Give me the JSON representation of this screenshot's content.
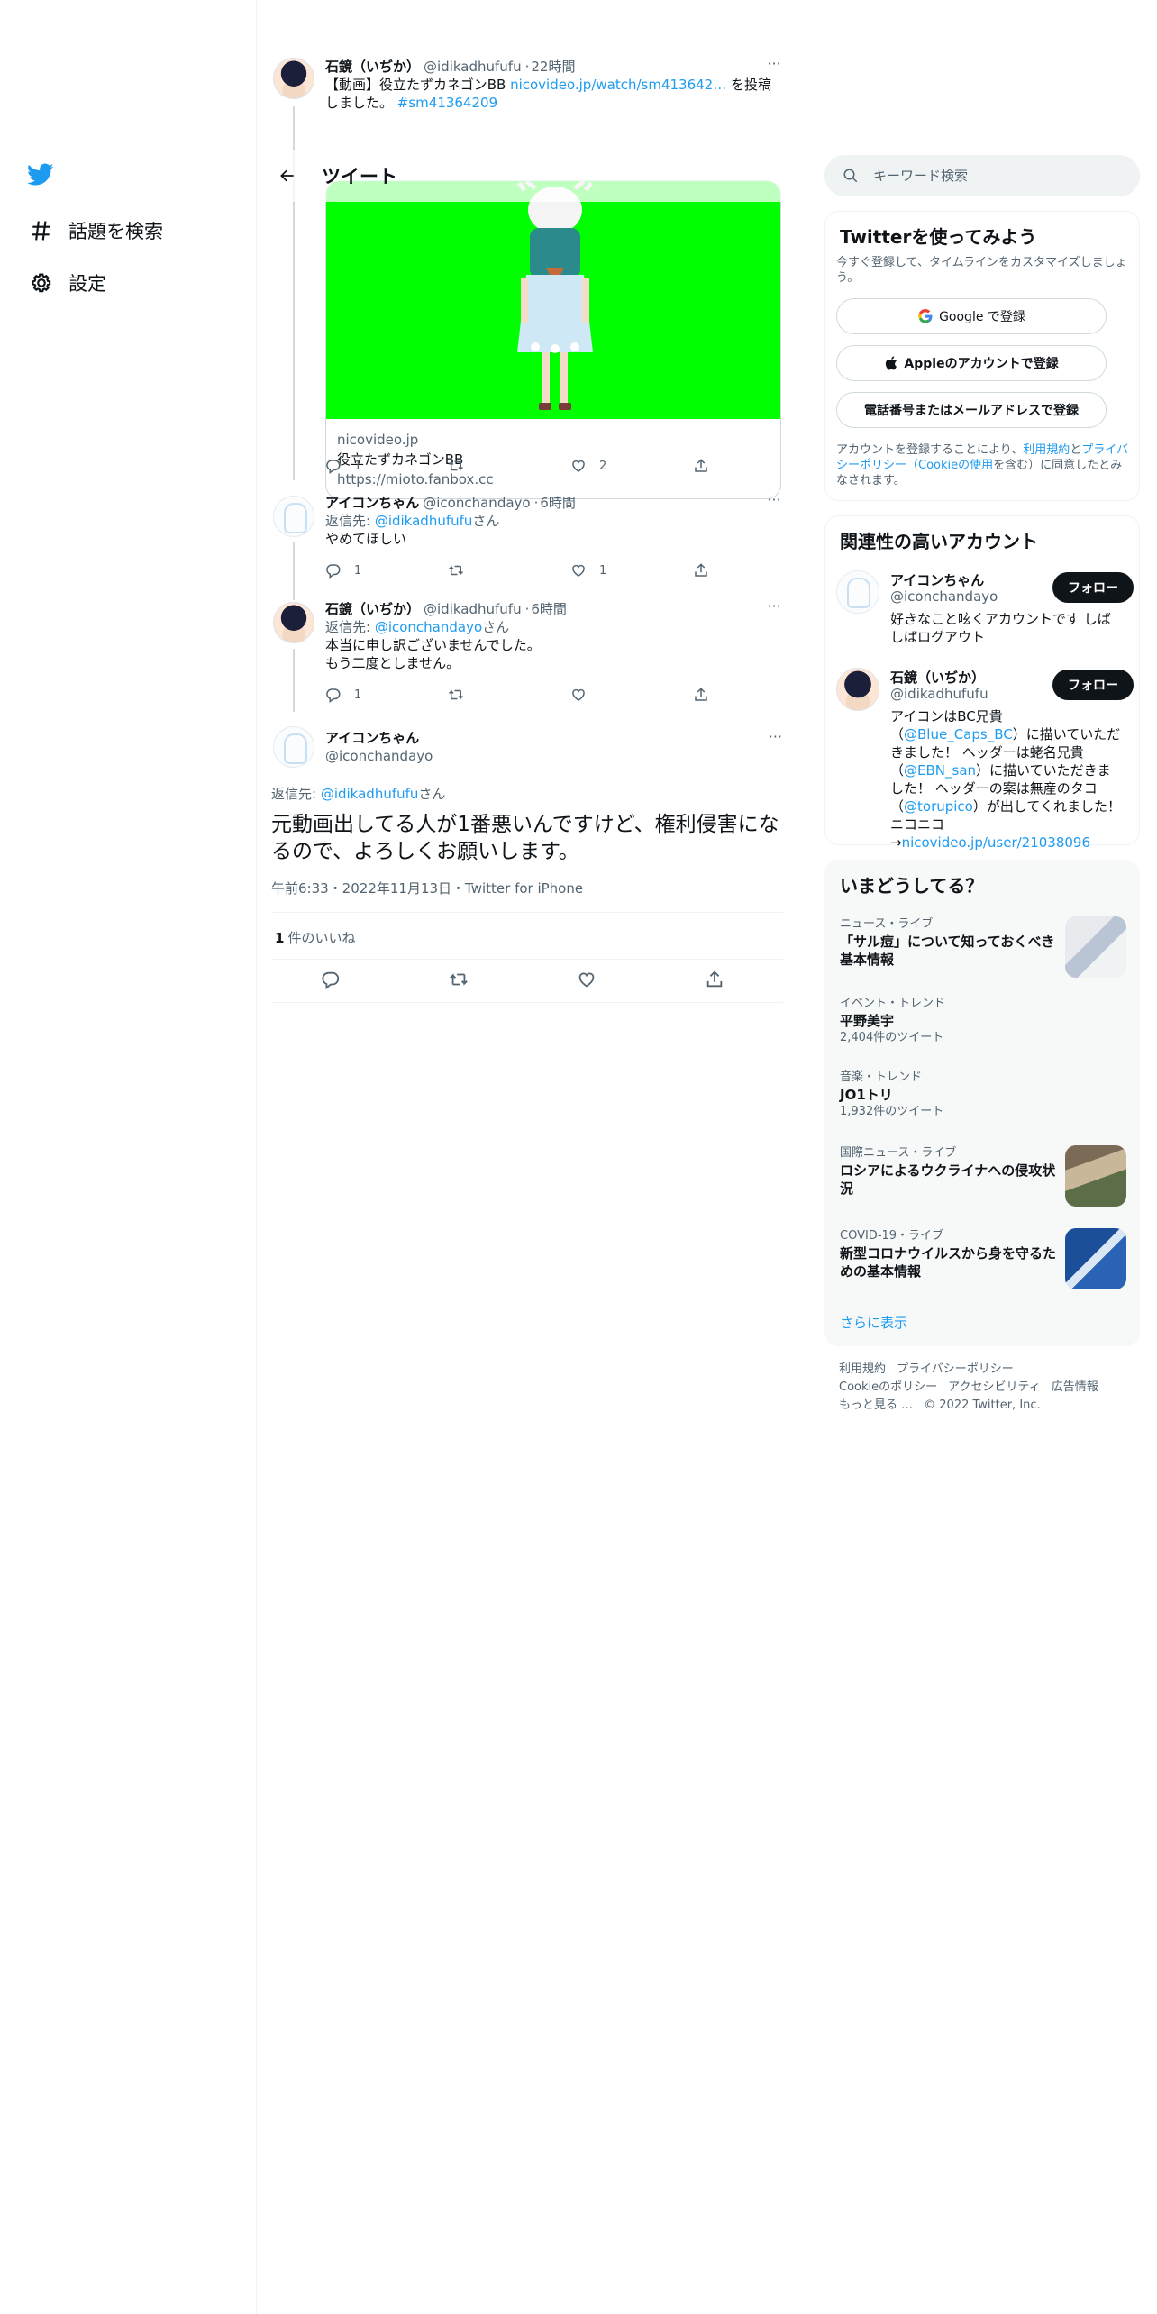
{
  "nav": {
    "explore_label": "話題を検索",
    "settings_label": "設定"
  },
  "header": {
    "title": "ツイート"
  },
  "tweets": [
    {
      "name": "石鏡（いぢか）",
      "handle": "@idikadhufufu",
      "time": "22時間",
      "text_prefix": "【動画】役立たずカネゴンBB ",
      "link": "nicovideo.jp/watch/sm413642…",
      "text_suffix": " を投稿しました。 ",
      "hashtag": "#sm41364209",
      "card": {
        "domain": "nicovideo.jp",
        "title": "役立たずカネゴンBB",
        "url": "https://mioto.fanbox.cc"
      },
      "replies": "1",
      "likes": "2"
    },
    {
      "name": "アイコンちゃん",
      "handle": "@iconchandayo",
      "time": "6時間",
      "reply_to_label": "返信先: ",
      "reply_to": "@idikadhufufu",
      "reply_to_suffix": "さん",
      "text": "やめてほしい",
      "replies": "1",
      "likes": "1"
    },
    {
      "name": "石鏡（いぢか）",
      "handle": "@idikadhufufu",
      "time": "6時間",
      "reply_to_label": "返信先: ",
      "reply_to": "@iconchandayo",
      "reply_to_suffix": "さん",
      "text_line1": "本当に申し訳ございませんでした。",
      "text_line2": "もう二度としません。",
      "replies": "1"
    }
  ],
  "focus": {
    "name": "アイコンちゃん",
    "handle": "@iconchandayo",
    "reply_to_label": "返信先: ",
    "reply_to": "@idikadhufufu",
    "reply_to_suffix": "さん",
    "text": "元動画出してる人が1番悪いんですけど、権利侵害になるので、よろしくお願いします。",
    "meta": "午前6:33・2022年11月13日・Twitter for iPhone",
    "likes_count": "1",
    "likes_label": "件のいいね"
  },
  "search": {
    "placeholder": "キーワード検索"
  },
  "signup": {
    "title": "Twitterを使ってみよう",
    "subtitle": "今すぐ登録して、タイムラインをカスタマイズしましょう。",
    "google": "Google で登録",
    "apple": "Appleのアカウントで登録",
    "phone": "電話番号またはメールアドレスで登録",
    "terms_1": "アカウントを登録することにより、",
    "terms_link1": "利用規約",
    "terms_2": "と",
    "terms_link2": "プライバシーポリシー（Cookieの使用",
    "terms_3": "を含む）に同意したとみなされます。"
  },
  "related": {
    "title": "関連性の高いアカウント",
    "follow_label": "フォロー",
    "accounts": [
      {
        "name": "アイコンちゃん",
        "handle": "@iconchandayo",
        "bio": "好きなこと呟くアカウントです しばしばログアウト"
      },
      {
        "name": "石鏡（いぢか）",
        "handle": "@idikadhufufu",
        "bio_1": "アイコンはBC兄貴（",
        "bio_link1": "@Blue_Caps_BC",
        "bio_2": "）に描いていただきました！ ヘッダーは蛯名兄貴（",
        "bio_link2": "@EBN_san",
        "bio_3": "）に描いていただきました！ ヘッダーの案は無産のタコ（",
        "bio_link3": "@torupico",
        "bio_4": "）が出してくれました！ ニコニコ→",
        "bio_link4": "nicovideo.jp/user/21038096"
      }
    ]
  },
  "trends": {
    "title": "いまどうしてる？",
    "items": [
      {
        "context": "ニュース・ライブ",
        "title": "「サル痘」について知っておくべき基本情報"
      },
      {
        "context": "イベント・トレンド",
        "title": "平野美宇",
        "count": "2,404件のツイート"
      },
      {
        "context": "音楽・トレンド",
        "title": "JO1トリ",
        "count": "1,932件のツイート"
      },
      {
        "context": "国際ニュース・ライブ",
        "title": "ロシアによるウクライナへの侵攻状況"
      },
      {
        "context": "COVID-19・ライブ",
        "title": "新型コロナウイルスから身を守るための基本情報"
      }
    ],
    "show_more": "さらに表示"
  },
  "footer": {
    "terms": "利用規約",
    "privacy": "プライバシーポリシー",
    "cookie": "Cookieのポリシー",
    "accessibility": "アクセシビリティ",
    "ads": "広告情報",
    "more": "もっと見る …",
    "copyright": "© 2022 Twitter, Inc."
  },
  "colors": {
    "accent": "#1d9bf0",
    "text": "#0f1419",
    "secondary": "#536471",
    "media_bg": "#00ff00"
  },
  "icons": [
    "twitter-bird-icon",
    "hashtag-icon",
    "gear-icon",
    "back-arrow-icon",
    "search-icon",
    "reply-icon",
    "retweet-icon",
    "like-icon",
    "share-icon",
    "more-icon",
    "google-icon",
    "apple-icon"
  ]
}
